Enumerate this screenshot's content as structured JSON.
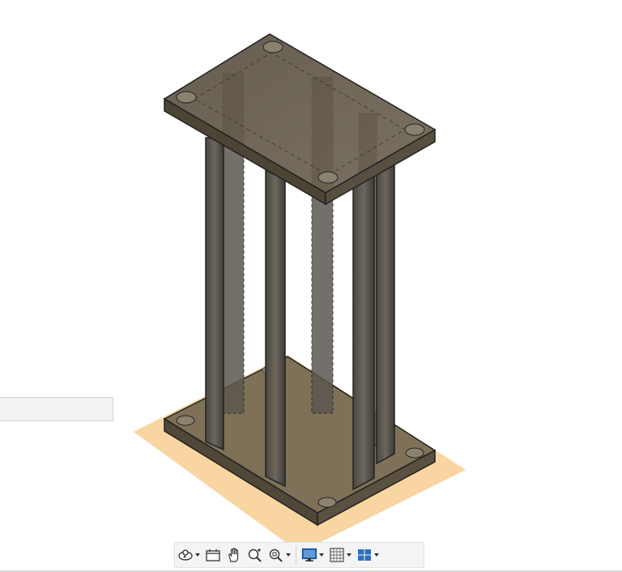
{
  "window": {
    "background": "#ffffff"
  },
  "model": {
    "body_color": "#5a5346",
    "edge_color": "#222222",
    "ground_plane_color": "#f6c47a"
  },
  "navigation_bar": {
    "tools": [
      {
        "name": "orbit-tool",
        "icon": "orbit-icon",
        "has_dropdown": true
      },
      {
        "name": "look-at-tool",
        "icon": "look-at-icon",
        "has_dropdown": false
      },
      {
        "name": "pan-tool",
        "icon": "pan-hand-icon",
        "has_dropdown": false
      },
      {
        "name": "zoom-tool",
        "icon": "zoom-icon",
        "has_dropdown": false
      },
      {
        "name": "fit-tool",
        "icon": "zoom-window-icon",
        "has_dropdown": true
      },
      {
        "name": "display-settings-tool",
        "icon": "monitor-icon",
        "has_dropdown": true
      },
      {
        "name": "grid-snaps-tool",
        "icon": "grid-icon",
        "has_dropdown": true
      },
      {
        "name": "viewports-tool",
        "icon": "multi-viewport-icon",
        "has_dropdown": true
      }
    ],
    "accent": "#2f6fb8"
  }
}
